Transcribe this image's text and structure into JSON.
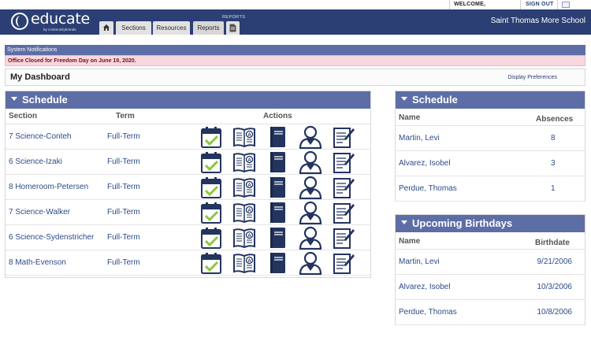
{
  "util": {
    "welcome": "WELCOME,",
    "signout": "SIGN OUT"
  },
  "header": {
    "logo_text": "educate",
    "logo_sub": "by communitybrands",
    "tabs": {
      "sections": "Sections",
      "resources": "Resources",
      "reports": "Reports"
    },
    "reports_caption": "REPORTS",
    "school": "Saint Thomas More School"
  },
  "notifications": {
    "title": "System Notifications",
    "message": "Office Closed for Freedom Day on June 19, 2020."
  },
  "dashboard": {
    "title": "My Dashboard",
    "prefs": "Display Preferences"
  },
  "schedule": {
    "title": "Schedule",
    "columns": {
      "section": "Section",
      "term": "Term",
      "actions": "Actions"
    },
    "rows": [
      {
        "section": "7 Science-Conteh",
        "term": "Full-Term"
      },
      {
        "section": "6 Science-Izaki",
        "term": "Full-Term"
      },
      {
        "section": "8 Homeroom-Petersen",
        "term": "Full-Term"
      },
      {
        "section": "7 Science-Walker",
        "term": "Full-Term"
      },
      {
        "section": "6 Science-Sydenstricher",
        "term": "Full-Term"
      },
      {
        "section": "8 Math-Evenson",
        "term": "Full-Term"
      }
    ],
    "action_icons": [
      "calendar-check-icon",
      "gradebook-icon",
      "book-icon",
      "students-icon",
      "lesson-plan-icon"
    ]
  },
  "absences": {
    "title": "Schedule",
    "columns": {
      "name": "Name",
      "absences": "Absences"
    },
    "rows": [
      {
        "name": "Martin, Levi",
        "value": "8"
      },
      {
        "name": "Alvarez, Isobel",
        "value": "3"
      },
      {
        "name": "Perdue, Thomas",
        "value": "1"
      }
    ]
  },
  "birthdays": {
    "title": "Upcoming Birthdays",
    "columns": {
      "name": "Name",
      "birthdate": "Birthdate"
    },
    "rows": [
      {
        "name": "Martin, Levi",
        "value": "9/21/2006"
      },
      {
        "name": "Alvarez, Isobel",
        "value": "10/3/2006"
      },
      {
        "name": "Perdue, Thomas",
        "value": "10/8/2006"
      }
    ]
  },
  "colors": {
    "navy": "#2c3f74",
    "panel_header": "#5d6ea6",
    "link": "#2c4b88",
    "check": "#8cc63f",
    "alert_bg": "#f6d8de"
  }
}
